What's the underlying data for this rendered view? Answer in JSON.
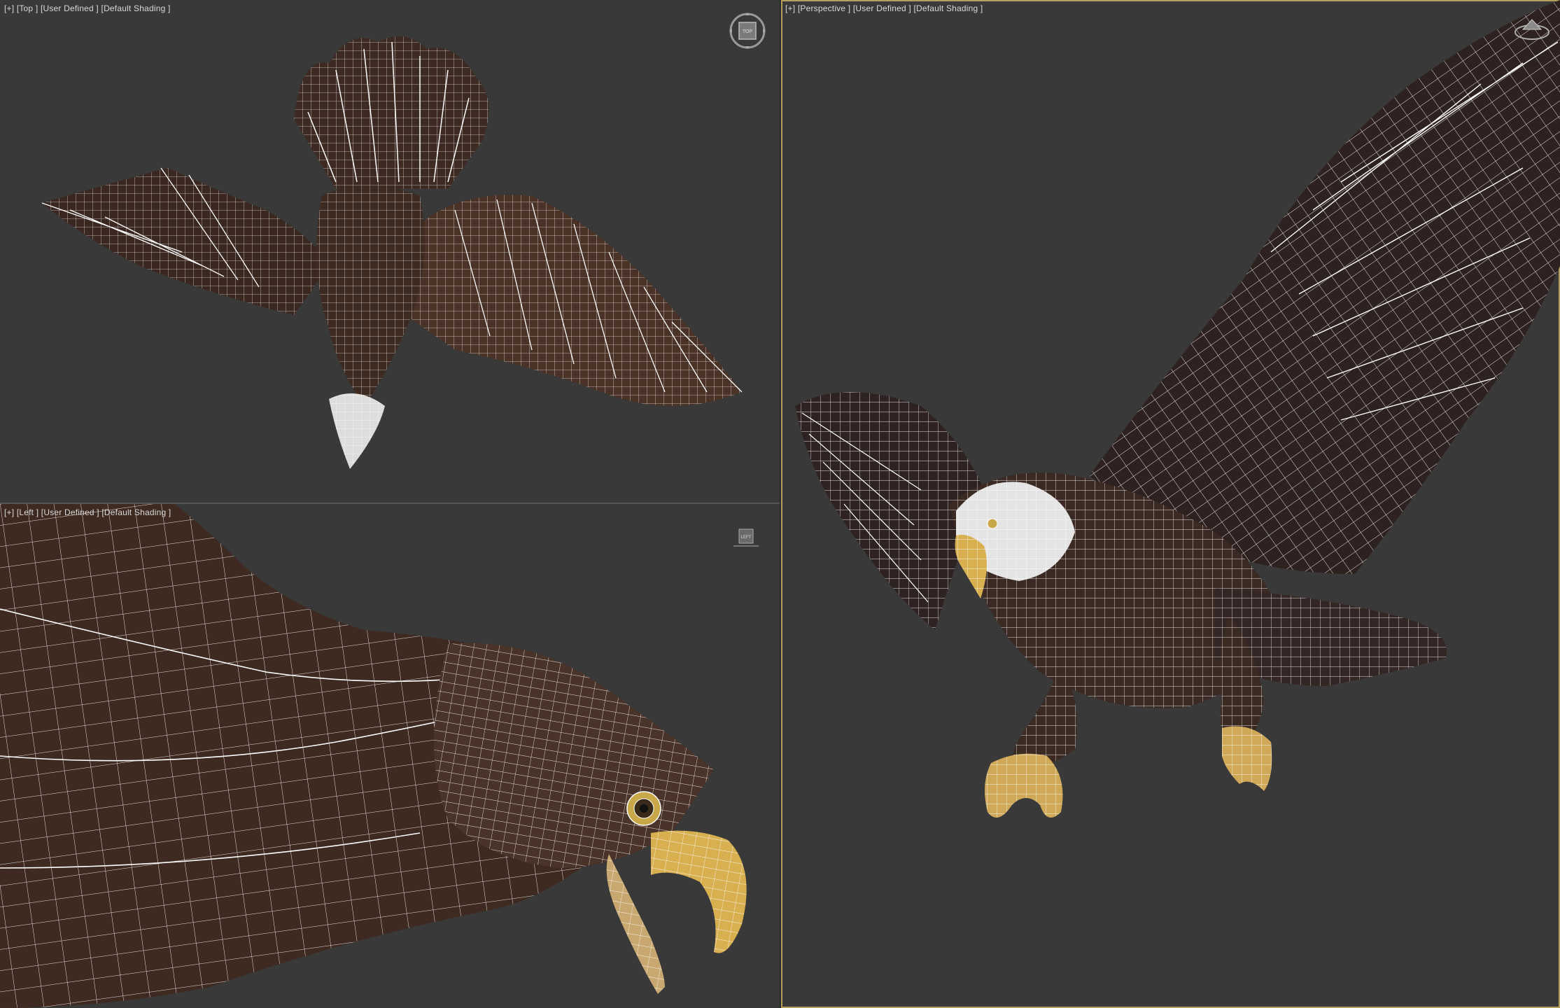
{
  "viewports": {
    "top": {
      "menu": "[+]",
      "view": "[Top ]",
      "camera": "[User Defined ]",
      "shading": "[Default Shading ]"
    },
    "left": {
      "menu": "[+]",
      "view": "[Left ]",
      "camera": "[User Defined ]",
      "shading": "[Default Shading ]"
    },
    "perspective": {
      "menu": "[+]",
      "view": "[Perspective ]",
      "camera": "[User Defined ]",
      "shading": "[Default Shading ]"
    }
  },
  "viewcube": {
    "top_face": "TOP",
    "left_face": "LEFT"
  },
  "colors": {
    "background": "#393939",
    "active_border": "#b4a05a",
    "wire": "#ffffff",
    "feather_dark": "#3a2820",
    "feather_mid": "#5a3f30",
    "beak": "#d8b050"
  },
  "icons": {
    "viewcube": "viewcube-icon",
    "steering_wheel": "steering-wheel-icon"
  }
}
